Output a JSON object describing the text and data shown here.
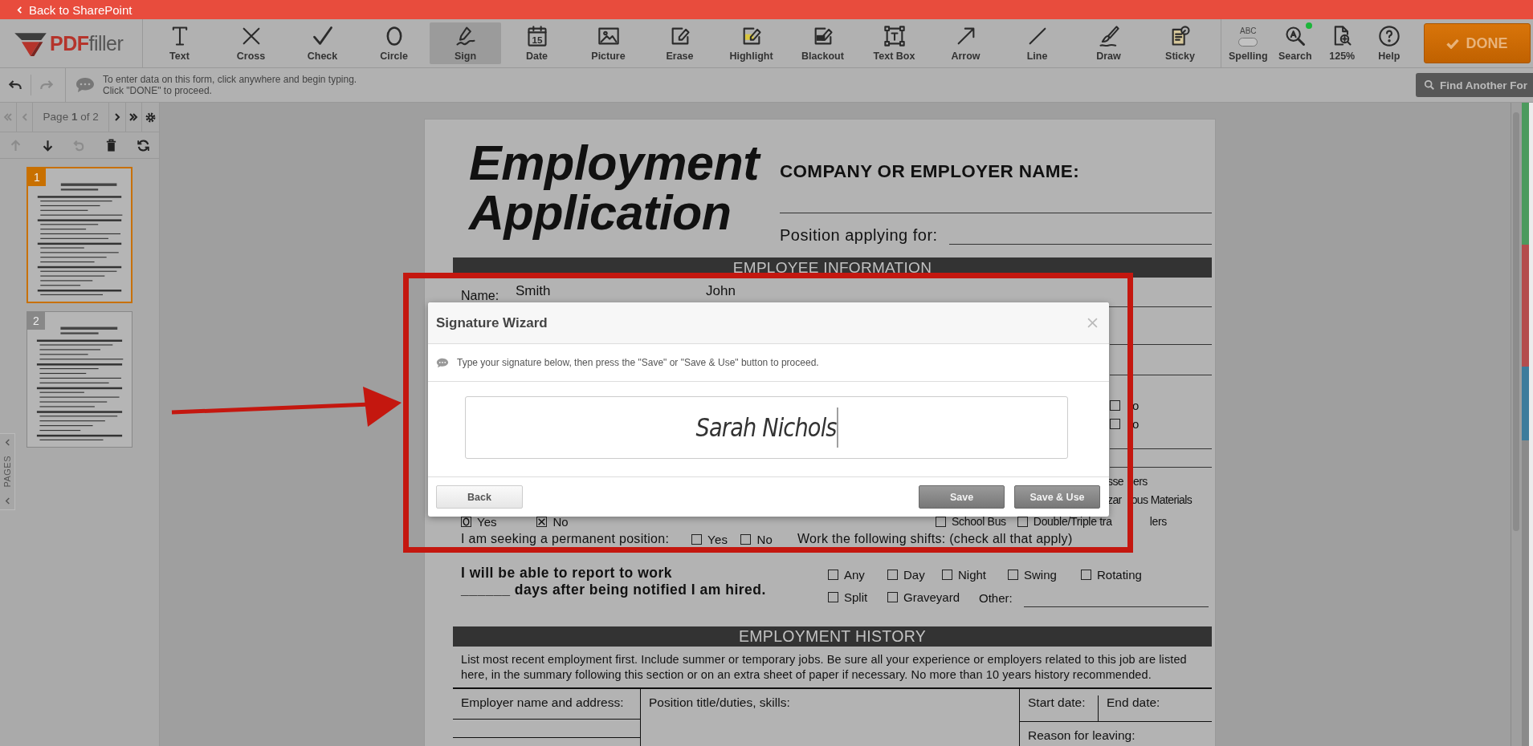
{
  "top_bar": {
    "back_link": "Back to SharePoint"
  },
  "toolbar": {
    "logo": [
      "PDF",
      "filler"
    ],
    "tools": [
      {
        "label": "Text",
        "kind": "text",
        "selected": false
      },
      {
        "label": "Cross",
        "kind": "cross",
        "selected": false
      },
      {
        "label": "Check",
        "kind": "check",
        "selected": false
      },
      {
        "label": "Circle",
        "kind": "circle",
        "selected": false
      },
      {
        "label": "Sign",
        "kind": "sign",
        "selected": true
      },
      {
        "label": "Date",
        "kind": "date",
        "selected": false,
        "icon_text": "15"
      },
      {
        "label": "Picture",
        "kind": "picture",
        "selected": false
      },
      {
        "label": "Erase",
        "kind": "erase",
        "selected": false
      },
      {
        "label": "Highlight",
        "kind": "highlight",
        "selected": false
      },
      {
        "label": "Blackout",
        "kind": "blackout",
        "selected": false
      },
      {
        "label": "Text Box",
        "kind": "textbox",
        "selected": false
      },
      {
        "label": "Arrow",
        "kind": "arrow",
        "selected": false
      },
      {
        "label": "Line",
        "kind": "line",
        "selected": false
      },
      {
        "label": "Draw",
        "kind": "draw",
        "selected": false
      },
      {
        "label": "Sticky",
        "kind": "sticky",
        "selected": false
      }
    ],
    "utilities": [
      {
        "label": "Spelling",
        "kind": "spelling",
        "icon_text": "ABC"
      },
      {
        "label": "Search",
        "kind": "search"
      },
      {
        "label": "125%",
        "kind": "zoom"
      },
      {
        "label": "Help",
        "kind": "help"
      }
    ],
    "done_button": "DONE"
  },
  "info_bar": {
    "message": [
      "To enter data on this form, click anywhere and begin typing.",
      "Click \"DONE\" to proceed."
    ],
    "find_button": "Find Another For"
  },
  "pages_panel": {
    "page_label": "Page **1** of 2",
    "actions": [
      {
        "kind": "up",
        "disabled": true
      },
      {
        "kind": "down",
        "disabled": false
      },
      {
        "kind": "rotate",
        "disabled": true
      },
      {
        "kind": "delete",
        "disabled": false
      },
      {
        "kind": "refresh",
        "disabled": false
      }
    ],
    "thumbnails": [
      {
        "number": "1",
        "selected": true
      },
      {
        "number": "2",
        "selected": false
      }
    ],
    "tab_label": "PAGES"
  },
  "document": {
    "title": [
      "Employment",
      "Application"
    ],
    "company_label": "COMPANY OR EMPLOYER NAME:",
    "position_label": "Position applying for:",
    "employee_section": "EMPLOYEE INFORMATION",
    "name_label": "Name:",
    "last_name": "Smith",
    "first_name": "John",
    "right_fragments": [
      {
        "label": "o",
        "checked": false
      },
      {
        "label": "o",
        "checked": false
      }
    ],
    "right_texts": [
      [
        "sse",
        "ers"
      ],
      [
        "zar",
        "ous Materials"
      ]
    ],
    "answer_row": [
      {
        "label": "Yes",
        "checked": true,
        "kind": "circle"
      },
      {
        "label": "No",
        "checked": true,
        "kind": "cross"
      }
    ],
    "vehicle_options": [
      {
        "label": "School Bus",
        "checked": false
      },
      {
        "label": "Double/Triple tra",
        "checked": false
      }
    ],
    "vehicle_tail": "lers",
    "permanent_label": "I am seeking a permanent position:",
    "permanent_options": [
      {
        "label": "Yes",
        "checked": false
      },
      {
        "label": "No",
        "checked": false
      }
    ],
    "shifts_label": "Work the following shifts: (check all that apply)",
    "report_lines": [
      "I will be able to report to work",
      "______ days after being notified I am hired."
    ],
    "shifts": [
      [
        {
          "label": "Any",
          "checked": false
        },
        {
          "label": "Day",
          "checked": false
        },
        {
          "label": "Night",
          "checked": false
        },
        {
          "label": "Swing",
          "checked": false
        },
        {
          "label": "Rotating",
          "checked": false
        }
      ],
      [
        {
          "label": "Split",
          "checked": false
        },
        {
          "label": "Graveyard",
          "checked": false
        }
      ]
    ],
    "other_label": "Other:",
    "history_section": "EMPLOYMENT HISTORY",
    "history_note": "List most recent employment first. Include summer or temporary jobs. Be sure all your experience or employers related to this job are listed here, in the summary following this section or on an extra sheet of paper if necessary. No more than 10 years history recommended.",
    "history_columns": [
      "Employer name and address:",
      "Position title/duties, skills:",
      "Start date:",
      "End date:"
    ],
    "reason_label": "Reason for leaving:"
  },
  "dialog": {
    "title": "Signature Wizard",
    "instruction": "Type your signature below, then press the \"Save\" or \"Save & Use\" button to proceed.",
    "signature": "Sarah Nichols",
    "buttons": [
      {
        "label": "Back",
        "kind": "secondary"
      },
      {
        "label": "Save",
        "kind": "primary"
      },
      {
        "label": "Save & Use",
        "kind": "primary"
      }
    ]
  }
}
